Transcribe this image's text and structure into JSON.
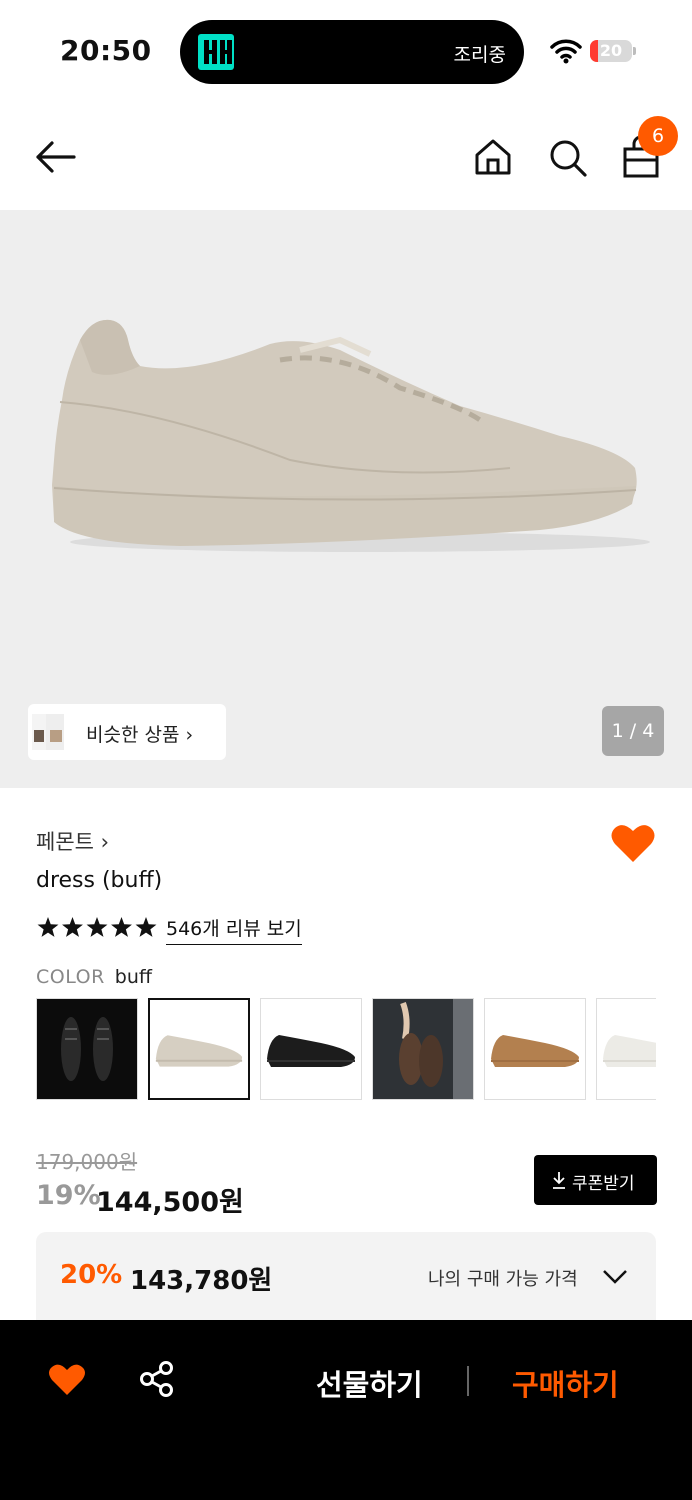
{
  "status_bar": {
    "time": "20:50",
    "island_text": "조리중",
    "battery_level": "20",
    "battery_fraction": 0.2,
    "icons": [
      "wifi-icon",
      "battery-icon"
    ]
  },
  "nav": {
    "icons": [
      "back-arrow-icon",
      "home-icon",
      "search-icon",
      "shopping-bag-icon"
    ],
    "cart_count": "6"
  },
  "gallery": {
    "similar_label": "비슷한 상품",
    "counter": "1 / 4"
  },
  "product": {
    "brand": "페몬트",
    "brand_chevron": "›",
    "name": "dress (buff)",
    "rating_stars": 5,
    "review_link": "546개 리뷰 보기",
    "color_label": "COLOR",
    "color_value": "buff",
    "color_options": [
      "black-lifestyle",
      "buff",
      "black",
      "brown-lifestyle",
      "tan",
      "white"
    ],
    "selected_color_index": 1
  },
  "pricing": {
    "original_price": "179,000원",
    "discount_rate": "19%",
    "price": "144,500원",
    "coupon_button": "쿠폰받기",
    "my_rate": "20%",
    "my_price": "143,780원",
    "my_label": "나의 구매 가능 가격"
  },
  "bottom_bar": {
    "gift_label": "선물하기",
    "buy_label": "구매하기"
  },
  "colors": {
    "accent": "#ff5a00",
    "hero_bg": "#eeeeee",
    "bottom_bar_bg": "#000000"
  }
}
